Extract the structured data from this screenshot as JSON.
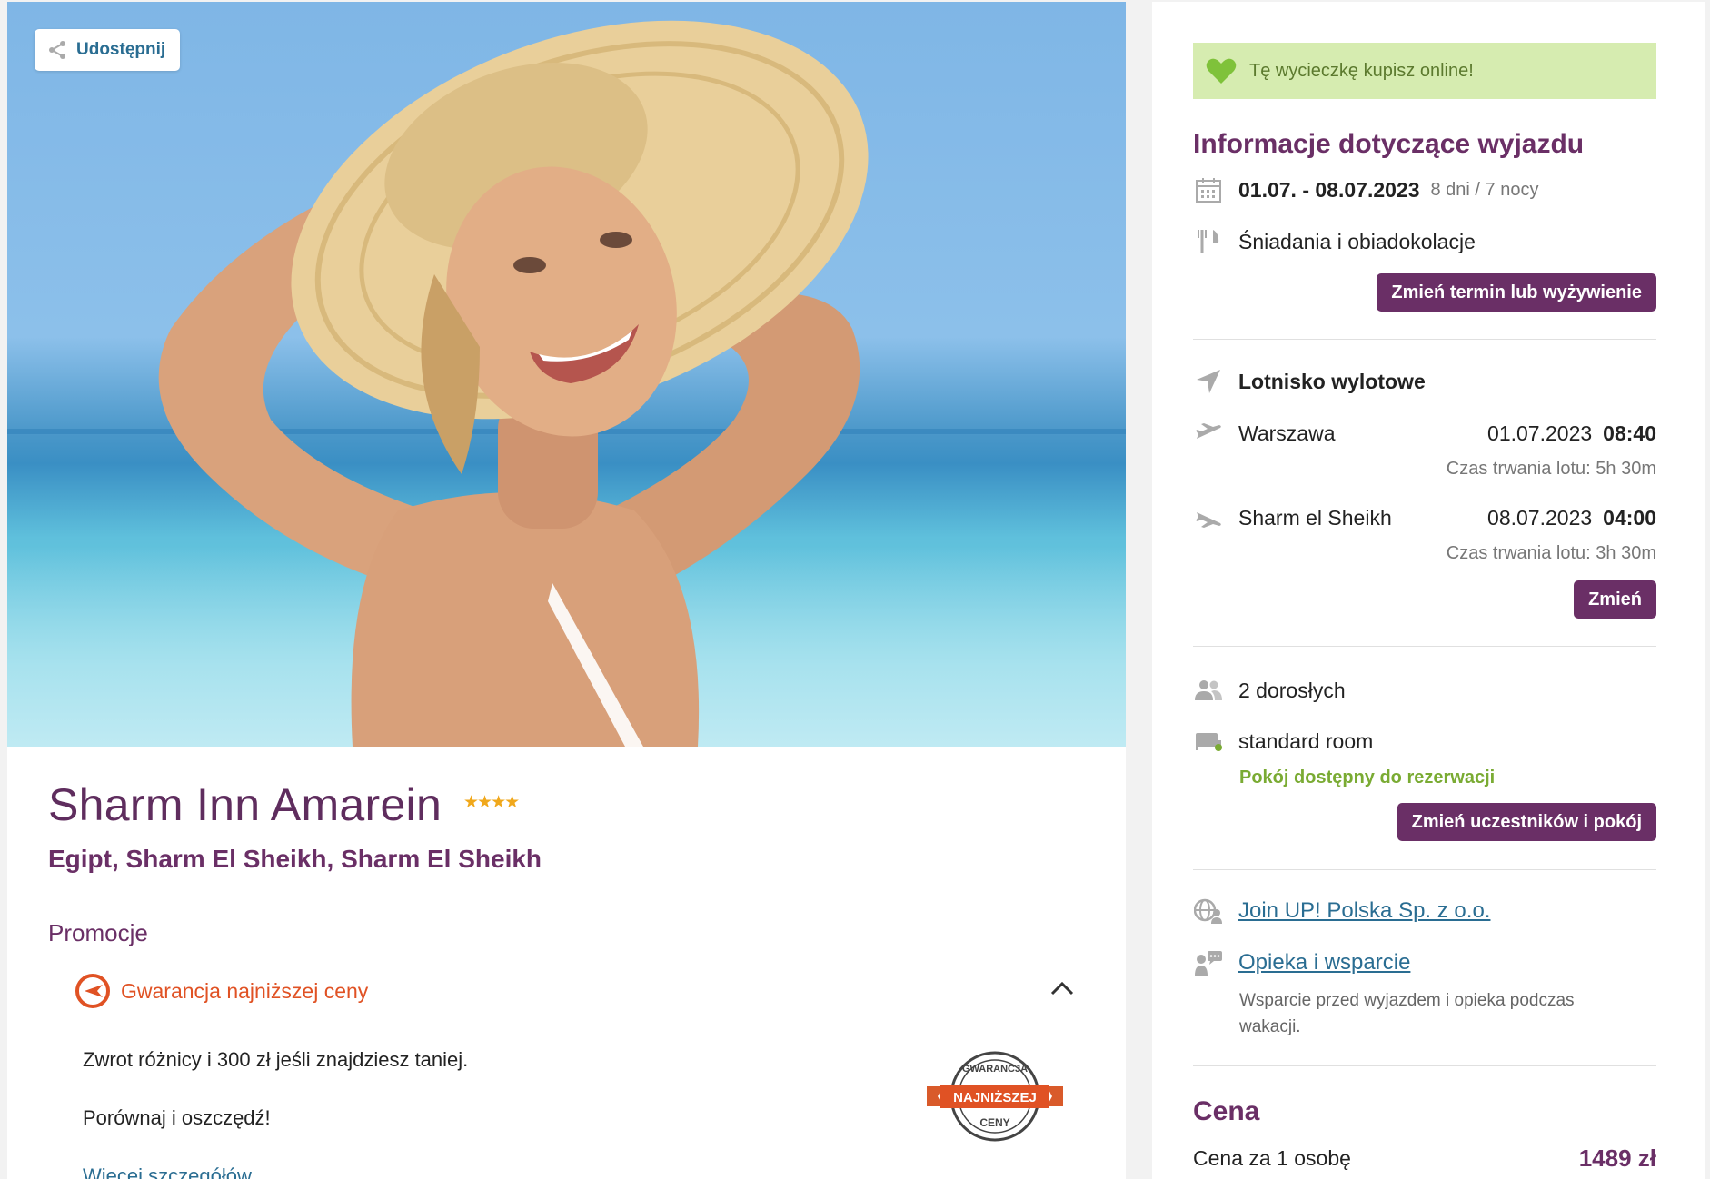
{
  "share": {
    "label": "Udostępnij"
  },
  "hotel": {
    "name": "Sharm Inn Amarein",
    "stars": "★★★★",
    "location": "Egipt, Sharm El Sheikh, Sharm El Sheikh"
  },
  "promotions": {
    "heading": "Promocje",
    "item_label": "Gwarancja najniższej ceny",
    "text1": "Zwrot różnicy i 300 zł jeśli znajdziesz taniej.",
    "text2": "Porównaj i oszczędź!",
    "more_link": "Więcej szczegółów",
    "badge": {
      "top": "GWARANCJA",
      "middle": "NAJNIŻSZEJ",
      "bottom": "CENY"
    }
  },
  "sidebar": {
    "banner": "Tę wycieczkę kupisz online!",
    "info_heading": "Informacje dotyczące wyjazdu",
    "dates": "01.07. - 08.07.2023",
    "duration": "8 dni / 7 nocy",
    "board": "Śniadania i obiadokolacje",
    "change_date_button": "Zmień termin lub wyżywienie",
    "airport_heading": "Lotnisko wylotowe",
    "outbound": {
      "city": "Warszawa",
      "date": "01.07.2023",
      "time": "08:40",
      "duration": "Czas trwania lotu: 5h 30m"
    },
    "return": {
      "city": "Sharm el Sheikh",
      "date": "08.07.2023",
      "time": "04:00",
      "duration": "Czas trwania lotu: 3h 30m"
    },
    "change_flight_button": "Zmień",
    "participants": "2 dorosłych",
    "room": "standard room",
    "room_availability": "Pokój dostępny do rezerwacji",
    "change_room_button": "Zmień uczestników i pokój",
    "operator_link": "Join UP! Polska Sp. z o.o.",
    "care_link": "Opieka i wsparcie",
    "care_desc": "Wsparcie przed wyjazdem i opieka podczas wakacji.",
    "price_heading": "Cena",
    "price_label": "Cena za 1 osobę",
    "price_value": "1489 zł"
  },
  "colors": {
    "brand": "#6a2f66",
    "link": "#2a6d92",
    "accent_green": "#7aab33",
    "promo_orange": "#e05224",
    "star": "#f0a81c"
  }
}
